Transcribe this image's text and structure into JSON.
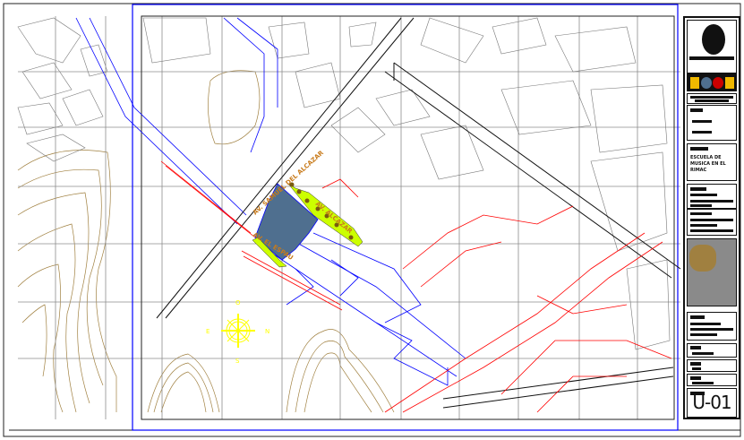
{
  "drawing": {
    "streets": [
      "AV. SAMUEL DEL ALCAZAR",
      "AV. ALCAZAR",
      "AV. EL ESPAU"
    ],
    "compass": {
      "north": "N",
      "south": "S",
      "east": "E",
      "west": "O"
    }
  },
  "title_block": {
    "project_title": "ESCUELA DE MUSICA EN EL RIMAC",
    "sheet_code": "U-01"
  },
  "colors": {
    "frame": "#0000ff",
    "roads": "#000000",
    "red_lines": "#ff0000",
    "contours": "#a08040",
    "site": "#4f6f8f",
    "green": "#ccff00",
    "grid": "#8c8c8c",
    "compass": "#ffff00"
  }
}
